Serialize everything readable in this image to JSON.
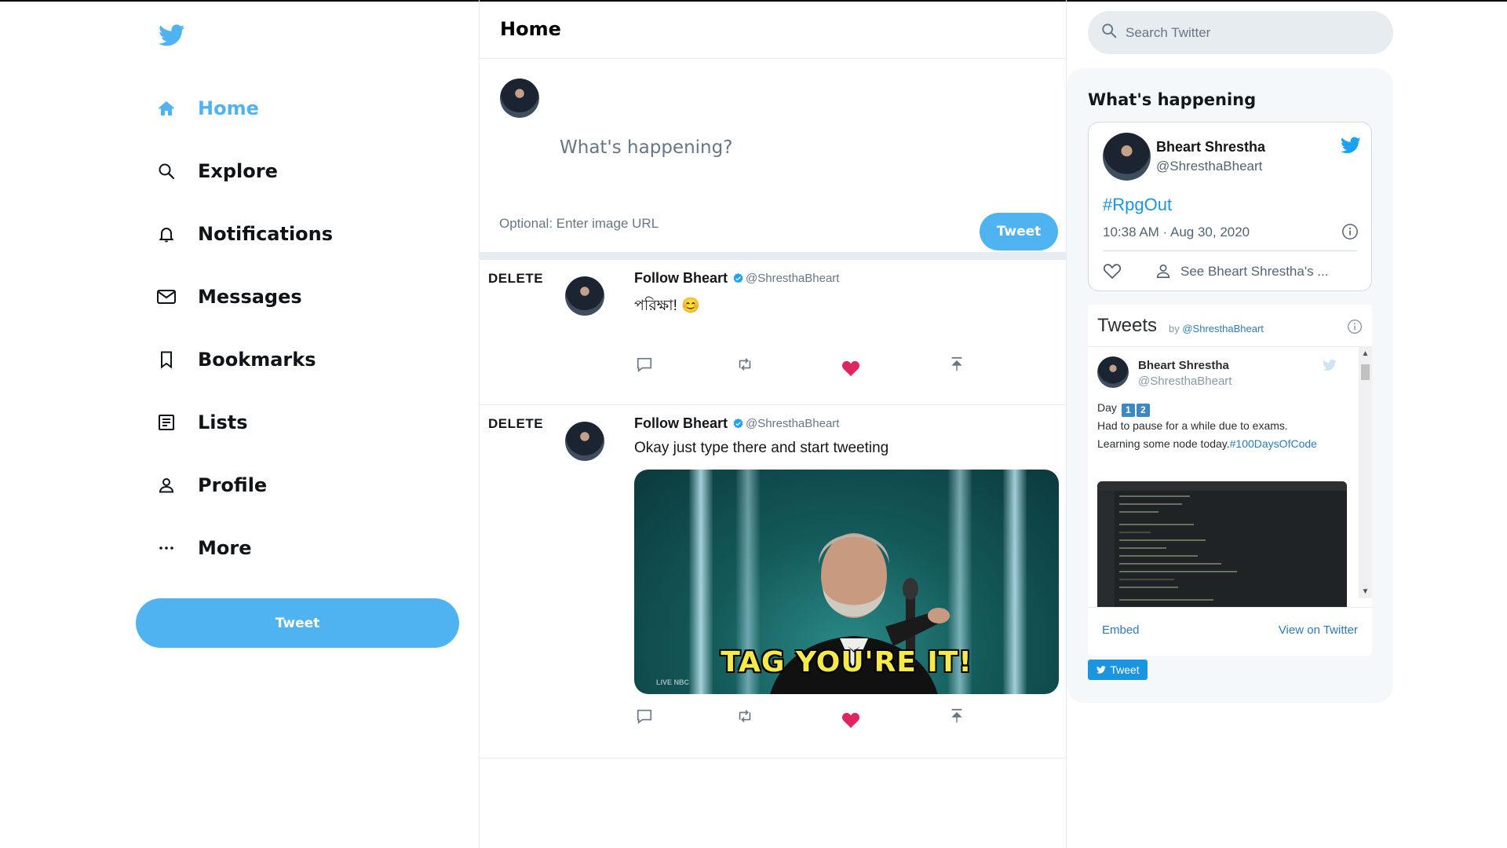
{
  "app": {
    "title": "Twitter"
  },
  "sidebar": {
    "items": [
      {
        "label": "Home",
        "icon": "home-icon",
        "active": true
      },
      {
        "label": "Explore",
        "icon": "search-icon"
      },
      {
        "label": "Notifications",
        "icon": "bell-icon"
      },
      {
        "label": "Messages",
        "icon": "mail-icon"
      },
      {
        "label": "Bookmarks",
        "icon": "bookmark-icon"
      },
      {
        "label": "Lists",
        "icon": "list-icon"
      },
      {
        "label": "Profile",
        "icon": "person-icon"
      },
      {
        "label": "More",
        "icon": "more-icon"
      }
    ],
    "tweet_button": "Tweet"
  },
  "main": {
    "title": "Home",
    "composer": {
      "placeholder": "What's happening?",
      "image_url_placeholder": "Optional: Enter image URL",
      "tweet_button": "Tweet"
    },
    "tweets": [
      {
        "delete_label": "DELETE",
        "name": "Follow Bheart",
        "handle": "@ShresthaBheart",
        "text": "পরিক্ষা! 😊",
        "liked": true
      },
      {
        "delete_label": "DELETE",
        "name": "Follow Bheart",
        "handle": "@ShresthaBheart",
        "text": "Okay just type there and start tweeting",
        "gif_caption": "TAG YOU'RE IT!",
        "gif_watermark": "LIVE NBC",
        "liked": true
      }
    ]
  },
  "right": {
    "search_placeholder": "Search Twitter",
    "panel_title": "What's happening",
    "embed": {
      "name": "Bheart Shrestha",
      "handle": "@ShresthaBheart",
      "hashtag": "#RpgOut",
      "time": "10:38 AM · Aug 30, 2020",
      "see_more": "See Bheart Shrestha's ..."
    },
    "timeline": {
      "title": "Tweets",
      "by": "by",
      "by_handle": "@ShresthaBheart",
      "tweet_name": "Bheart Shrestha",
      "tweet_handle": "@ShresthaBheart",
      "day_label": "Day",
      "day_digits": [
        "1",
        "2"
      ],
      "line1": "Had to pause for a while due to exams.",
      "line2": "Learning some node today.",
      "line2_link": "#100DaysOfCode",
      "embed_link": "Embed",
      "view_link": "View on Twitter"
    },
    "small_tweet_button": "Tweet"
  },
  "colors": {
    "brand": "#4fb3f2",
    "like": "#e0245e",
    "link": "#1b95e0",
    "keycap": "#3b88c3"
  }
}
